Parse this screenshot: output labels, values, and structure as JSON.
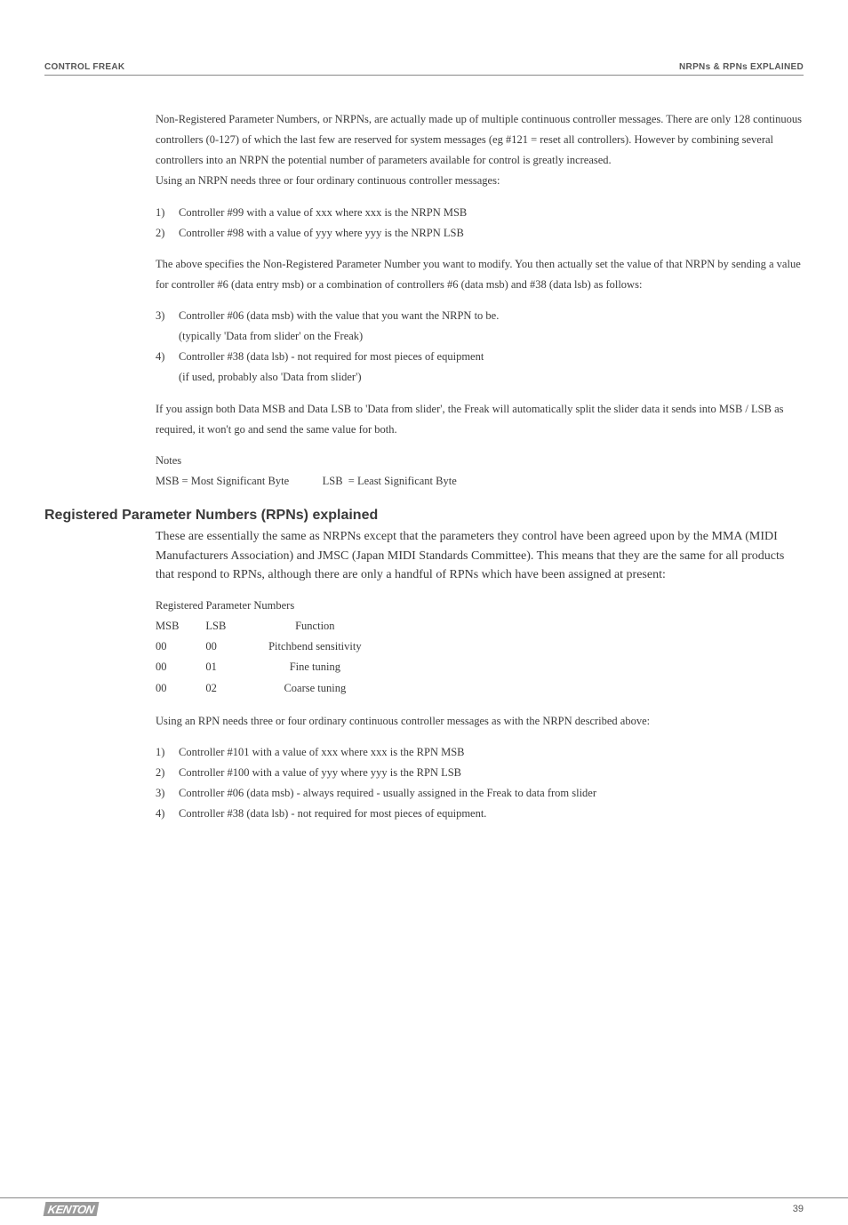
{
  "header": {
    "left": "CONTROL FREAK",
    "right": "NRPNs & RPNs EXPLAINED"
  },
  "p1": "Non-Registered Parameter Numbers, or NRPNs, are actually made up of multiple continuous controller messages.  There are only 128 continuous controllers (0-127) of which the last few are reserved for system messages (eg #121 = reset all controllers). However by combining several controllers into an NRPN the potential number of parameters available for control is greatly increased.",
  "p1b": "Using an NRPN needs three or four ordinary continuous controller messages:",
  "listA": [
    {
      "n": "1)",
      "t": "Controller #99 with a value of xxx where xxx is the NRPN MSB"
    },
    {
      "n": "2)",
      "t": "Controller #98 with a value of yyy where yyy is the NRPN LSB"
    }
  ],
  "p2": "The above specifies the Non-Registered Parameter Number you want to modify. You then actually set  the value of that NRPN by sending a value for controller #6 (data entry msb) or a combination of controllers #6 (data msb) and #38 (data lsb) as follows:",
  "listB": [
    {
      "n": "3)",
      "t": "Controller #06 (data msb) with the value that you want the NRPN  to be.",
      "sub": "(typically 'Data from slider' on the Freak)"
    },
    {
      "n": "4)",
      "t": "Controller #38 (data lsb) - not required for most pieces of equipment",
      "sub": "(if used, probably also 'Data from slider')"
    }
  ],
  "p3": "If you assign both Data MSB and Data LSB to 'Data from slider', the Freak will automatically split the slider data it sends into MSB / LSB as required, it won't go and send the same value for both.",
  "notes_label": "Notes",
  "notes_line": "MSB = Most Significant Byte            LSB  = Least Significant Byte",
  "section_heading": "Registered Parameter Numbers (RPNs) explained",
  "intro": "These are essentially the same as NRPNs except that the parameters they control have been agreed upon by the MMA (MIDI Manufacturers Association) and JMSC (Japan MIDI Standards Committee).  This means that they are the same for all products that respond to RPNs, although there are only a handful of RPNs which have been assigned at present:",
  "rpn_title": "Registered Parameter Numbers",
  "rpn_header": {
    "c1": "MSB",
    "c2": "LSB",
    "c3": "Function"
  },
  "rpn_rows": [
    {
      "c1": "00",
      "c2": "00",
      "c3": "Pitchbend sensitivity"
    },
    {
      "c1": "00",
      "c2": "01",
      "c3": "Fine tuning"
    },
    {
      "c1": "00",
      "c2": "02",
      "c3": "Coarse tuning"
    }
  ],
  "p4": "Using an RPN needs three or four ordinary continuous controller messages as with the NRPN described above:",
  "listC": [
    {
      "n": "1)",
      "t": "Controller #101 with a value of xxx where xxx is the RPN MSB"
    },
    {
      "n": "2)",
      "t": "Controller #100 with a value of yyy where yyy is the RPN LSB"
    },
    {
      "n": "3)",
      "t": "Controller #06 (data msb) - always required - usually assigned in the Freak to data from slider"
    },
    {
      "n": "4)",
      "t": "Controller #38 (data lsb) - not required for most pieces of equipment."
    }
  ],
  "footer": {
    "logo": "KENTON",
    "page": "39"
  }
}
